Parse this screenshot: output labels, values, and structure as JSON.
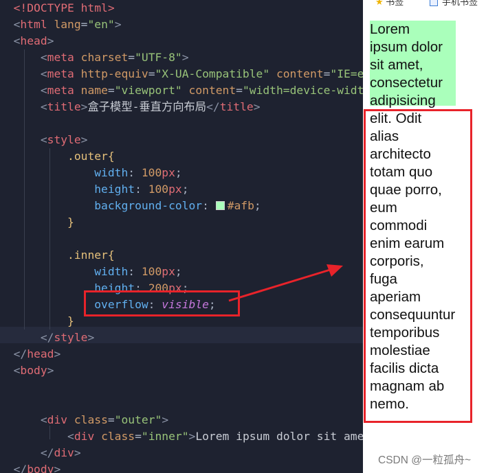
{
  "editor": {
    "lines": [
      [
        [
          "tg",
          "<!DOCTYPE html>"
        ]
      ],
      [
        [
          "br",
          "<"
        ],
        [
          "tg",
          "html "
        ],
        [
          "at",
          "lang"
        ],
        [
          "eq",
          "="
        ],
        [
          "st",
          "\"en\""
        ],
        [
          "br",
          ">"
        ]
      ],
      [
        [
          "br",
          "<"
        ],
        [
          "tg",
          "head"
        ],
        [
          "br",
          ">"
        ]
      ],
      [
        [
          "pl",
          "    "
        ],
        [
          "br",
          "<"
        ],
        [
          "tg",
          "meta "
        ],
        [
          "at",
          "charset"
        ],
        [
          "eq",
          "="
        ],
        [
          "st",
          "\"UTF-8\""
        ],
        [
          "br",
          ">"
        ]
      ],
      [
        [
          "pl",
          "    "
        ],
        [
          "br",
          "<"
        ],
        [
          "tg",
          "meta "
        ],
        [
          "at",
          "http-equiv"
        ],
        [
          "eq",
          "="
        ],
        [
          "st",
          "\"X-UA-Compatible\""
        ],
        [
          "pl",
          " "
        ],
        [
          "at",
          "content"
        ],
        [
          "eq",
          "="
        ],
        [
          "st",
          "\"IE=edge\""
        ],
        [
          "br",
          ">"
        ]
      ],
      [
        [
          "pl",
          "    "
        ],
        [
          "br",
          "<"
        ],
        [
          "tg",
          "meta "
        ],
        [
          "at",
          "name"
        ],
        [
          "eq",
          "="
        ],
        [
          "st",
          "\"viewport\""
        ],
        [
          "pl",
          " "
        ],
        [
          "at",
          "content"
        ],
        [
          "eq",
          "="
        ],
        [
          "st",
          "\"width=device-width\""
        ],
        [
          "br",
          ">"
        ]
      ],
      [
        [
          "pl",
          "    "
        ],
        [
          "br",
          "<"
        ],
        [
          "tg",
          "title"
        ],
        [
          "br",
          ">"
        ],
        [
          "tx",
          "盒子模型-垂直方向布局"
        ],
        [
          "br",
          "</"
        ],
        [
          "tg",
          "title"
        ],
        [
          "br",
          ">"
        ]
      ],
      [],
      [
        [
          "pl",
          "    "
        ],
        [
          "br",
          "<"
        ],
        [
          "tg",
          "style"
        ],
        [
          "br",
          ">"
        ]
      ],
      [
        [
          "pl",
          "        "
        ],
        [
          "sel",
          ".outer{"
        ]
      ],
      [
        [
          "pl",
          "            "
        ],
        [
          "pr",
          "width"
        ],
        [
          "pl",
          ": "
        ],
        [
          "nm",
          "100"
        ],
        [
          "un",
          "px"
        ],
        [
          "pl",
          ";"
        ]
      ],
      [
        [
          "pl",
          "            "
        ],
        [
          "pr",
          "height"
        ],
        [
          "pl",
          ": "
        ],
        [
          "nm",
          "100"
        ],
        [
          "un",
          "px"
        ],
        [
          "pl",
          ";"
        ]
      ],
      [
        [
          "pl",
          "            "
        ],
        [
          "pr",
          "background-color"
        ],
        [
          "pl",
          ": "
        ],
        [
          "swatch",
          ""
        ],
        [
          "nm",
          "#afb"
        ],
        [
          "pl",
          ";"
        ]
      ],
      [
        [
          "pl",
          "        "
        ],
        [
          "sel",
          "}"
        ]
      ],
      [],
      [
        [
          "pl",
          "        "
        ],
        [
          "sel",
          ".inner{"
        ]
      ],
      [
        [
          "pl",
          "            "
        ],
        [
          "pr",
          "width"
        ],
        [
          "pl",
          ": "
        ],
        [
          "nm",
          "100"
        ],
        [
          "un",
          "px"
        ],
        [
          "pl",
          ";"
        ]
      ],
      [
        [
          "pl",
          "            "
        ],
        [
          "pr",
          "height"
        ],
        [
          "pl",
          ": "
        ],
        [
          "nm",
          "200"
        ],
        [
          "un",
          "px"
        ],
        [
          "pl",
          ";"
        ]
      ],
      [
        [
          "pl",
          "            "
        ],
        [
          "pr",
          "overflow"
        ],
        [
          "pl",
          ": "
        ],
        [
          "kw",
          "visible"
        ],
        [
          "pl",
          ";"
        ]
      ],
      [
        [
          "pl",
          "        "
        ],
        [
          "sel",
          "}"
        ]
      ],
      [
        [
          "pl",
          "    "
        ],
        [
          "br",
          "</"
        ],
        [
          "tg",
          "style"
        ],
        [
          "br",
          ">"
        ]
      ],
      [
        [
          "br",
          "</"
        ],
        [
          "tg",
          "head"
        ],
        [
          "br",
          ">"
        ]
      ],
      [
        [
          "br",
          "<"
        ],
        [
          "tg",
          "body"
        ],
        [
          "br",
          ">"
        ]
      ],
      [],
      [],
      [
        [
          "pl",
          "    "
        ],
        [
          "br",
          "<"
        ],
        [
          "tg",
          "div "
        ],
        [
          "at",
          "class"
        ],
        [
          "eq",
          "="
        ],
        [
          "st",
          "\"outer\""
        ],
        [
          "br",
          ">"
        ]
      ],
      [
        [
          "pl",
          "        "
        ],
        [
          "br",
          "<"
        ],
        [
          "tg",
          "div "
        ],
        [
          "at",
          "class"
        ],
        [
          "eq",
          "="
        ],
        [
          "st",
          "\"inner\""
        ],
        [
          "br",
          ">"
        ],
        [
          "tx",
          "Lorem ipsum dolor sit amet, consectetur"
        ]
      ],
      [
        [
          "pl",
          "    "
        ],
        [
          "br",
          "</"
        ],
        [
          "tg",
          "div"
        ],
        [
          "br",
          ">"
        ]
      ],
      [
        [
          "br",
          "</"
        ],
        [
          "tg",
          "body"
        ],
        [
          "br",
          ">"
        ]
      ]
    ]
  },
  "preview": {
    "bookmarks": [
      {
        "icon": "star-icon",
        "label": "书签"
      },
      {
        "icon": "document-icon",
        "label": "手机书签"
      }
    ],
    "inner_text_lines": [
      "Lorem",
      "ipsum dolor",
      "sit amet,",
      "consectetur",
      "adipisicing",
      "elit. Odit",
      "alias",
      "architecto",
      "totam quo",
      "quae porro,",
      "eum",
      "commodi",
      "enim earum",
      "corporis,",
      "fuga",
      "aperiam",
      "consequuntur",
      "temporibus",
      "molestiae",
      "facilis dicta",
      "magnam ab",
      "nemo."
    ],
    "outer_background": "#aaffbb",
    "watermark": "CSDN @一粒孤舟~"
  },
  "annotation_color": "#e8232a"
}
